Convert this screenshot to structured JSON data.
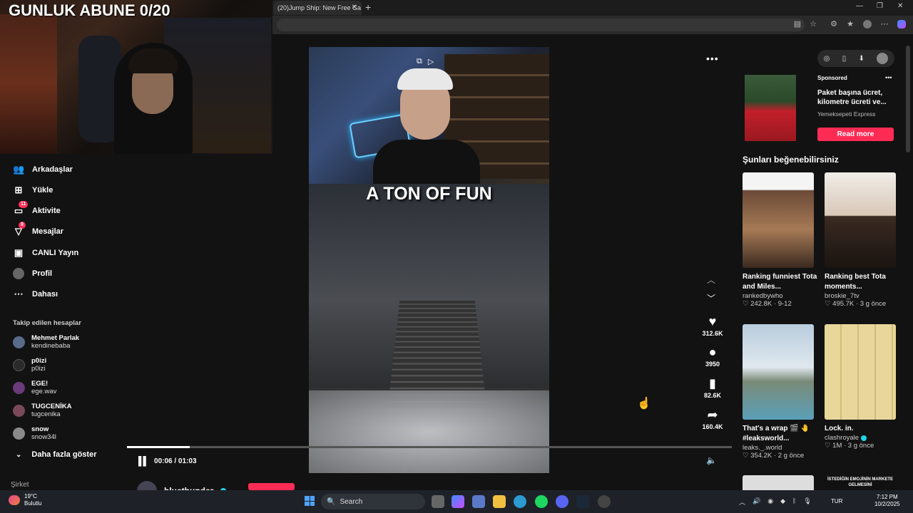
{
  "overlay": {
    "sub_counter": "GUNLUK ABUNE 0/20"
  },
  "browser": {
    "tab_title": "(20)Jump Ship: New Free Ga",
    "tab_close": "✕",
    "new_tab": "+",
    "window_controls": [
      "—",
      "❐",
      "✕"
    ]
  },
  "sidebar": {
    "nav": [
      {
        "label": "Arkadaşlar",
        "icon": "friends-icon",
        "glyph": "👥"
      },
      {
        "label": "Yükle",
        "icon": "upload-icon",
        "glyph": "⊞"
      },
      {
        "label": "Aktivite",
        "icon": "activity-icon",
        "glyph": "💬",
        "badge": "11"
      },
      {
        "label": "Mesajlar",
        "icon": "messages-icon",
        "glyph": "▽",
        "badge": "9"
      },
      {
        "label": "CANLI Yayın",
        "icon": "live-icon",
        "glyph": "📺"
      },
      {
        "label": "Profil",
        "icon": "profile-icon",
        "glyph": "●"
      },
      {
        "label": "Dahası",
        "icon": "more-icon",
        "glyph": "⋯"
      }
    ],
    "following_title": "Takip edilen hesaplar",
    "accounts": [
      {
        "name": "Mehmet Parlak",
        "handle": "kendinebaba",
        "color": "#5a6a8a"
      },
      {
        "name": "p0izi",
        "handle": "p0izi",
        "color": "#2a2a2a"
      },
      {
        "name": "EGE!",
        "handle": "ege.wav",
        "color": "#6a3a7a"
      },
      {
        "name": "TUGCENİKA",
        "handle": "tugcenika",
        "color": "#7a4a5a"
      },
      {
        "name": "snow",
        "handle": "snow34l",
        "color": "#8a8a8a"
      }
    ],
    "show_more": "Daha fazla göster",
    "company": "Şirket"
  },
  "video": {
    "caption": "A TON OF FUN",
    "time": "00:06 / 01:03",
    "progress": 0.104,
    "author": "bluethunder",
    "actions": [
      {
        "icon": "heart-icon",
        "glyph": "♥",
        "count": "312.6K"
      },
      {
        "icon": "comment-icon",
        "glyph": "💬",
        "count": "3950"
      },
      {
        "icon": "bookmark-icon",
        "glyph": "🔖",
        "count": "82.6K"
      },
      {
        "icon": "share-icon",
        "glyph": "➦",
        "count": "160.4K"
      }
    ]
  },
  "ad": {
    "sponsored": "Sponsored",
    "title": "Paket başına ücret, kilometre ücreti ve...",
    "brand": "Yemeksepeti Express",
    "cta": "Read more"
  },
  "suggestions": {
    "title": "Şunları beğenebilirsiniz",
    "cards": [
      {
        "title": "Ranking funniest Tota and Miles...",
        "author": "rankedbywho",
        "verified": false,
        "meta": "♡ 242.8K · 9-12",
        "bg": "linear-gradient(180deg,#f4f4f4 0%,#f4f4f4 18%,#6b4a38 19%,#a67a55 60%,#3a2a20 100%)"
      },
      {
        "title": "Ranking best Tota moments...",
        "author": "broskie_7tv",
        "verified": false,
        "meta": "♡ 495.7K · 3 g önce",
        "bg": "linear-gradient(180deg,#f0ede8 0%,#d8c8b8 45%,#3a2a22 46%,#1a1410 100%)"
      },
      {
        "title": "That's a wrap 🎬 🤚 #leaksworld...",
        "author": "leaks._.world",
        "verified": false,
        "meta": "♡ 354.2K · 2 g önce",
        "bg": "linear-gradient(180deg,#b8ccdc 0%,#dfe8ee 45%,#7a8a78 60%,#5aa0b8 100%)"
      },
      {
        "title": "Lock. in.",
        "author": "clashroyale",
        "verified": true,
        "meta": "♡ 1M · 3 g önce",
        "bg": "repeating-linear-gradient(90deg,#e8d79a 0 22px,#cfbd7a 22px 24px)"
      }
    ],
    "next_caption": "İSTEDİĞİN EMOJİNİN MARKETE GELMESİNİ"
  },
  "taskbar": {
    "temp": "19°C",
    "weather": "Bulutlu",
    "search": "Search",
    "lang": "TUR",
    "time": "7:12 PM",
    "date": "10/2/2025"
  }
}
